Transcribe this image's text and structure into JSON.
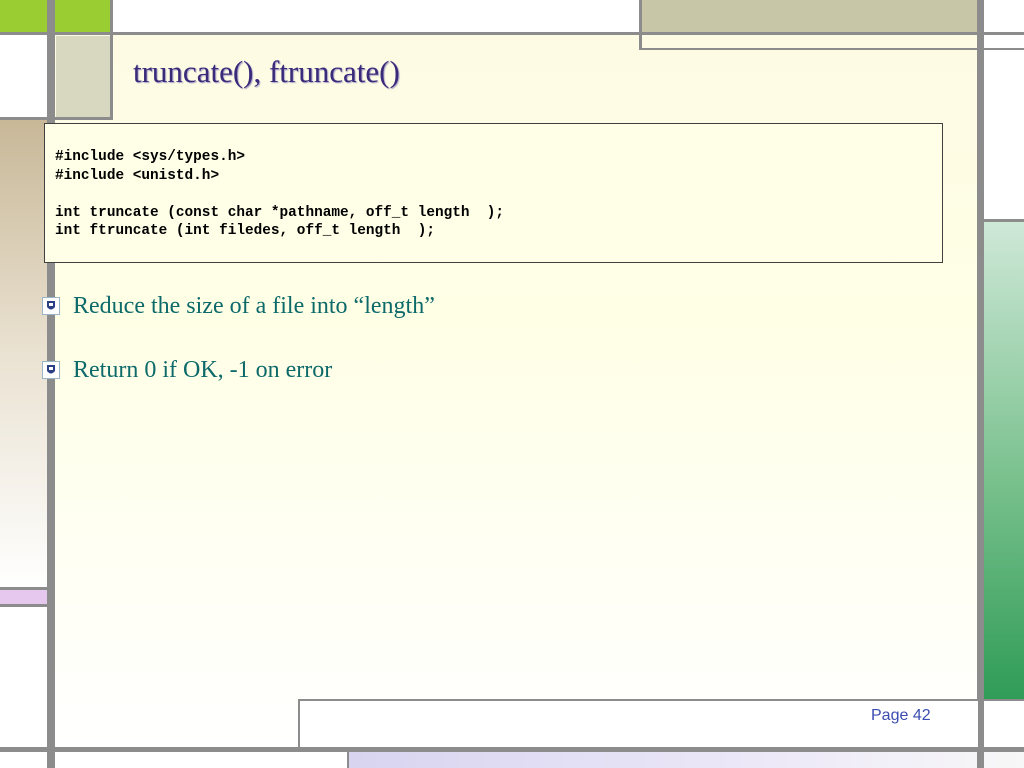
{
  "slide": {
    "title": "truncate(), ftruncate()",
    "code_lines": [
      "#include <sys/types.h>",
      "#include <unistd.h>",
      "",
      "int truncate (const char *pathname, off_t length  );",
      "int ftruncate (int filedes, off_t length  );"
    ],
    "bullets": [
      {
        "text": "Reduce the size of a file into “length”",
        "icon": "bullet-emblem-icon"
      },
      {
        "text": "Return 0 if OK, -1 on error",
        "icon": "bullet-emblem-icon"
      }
    ],
    "footer": {
      "page_label": "Page 42"
    }
  },
  "colors": {
    "title": "#3a2a7a",
    "bullet_text": "#0e6a6a",
    "page_label": "#3a4cb0",
    "accent_green": "#9acd32",
    "right_stripe": "#2f9c57"
  }
}
